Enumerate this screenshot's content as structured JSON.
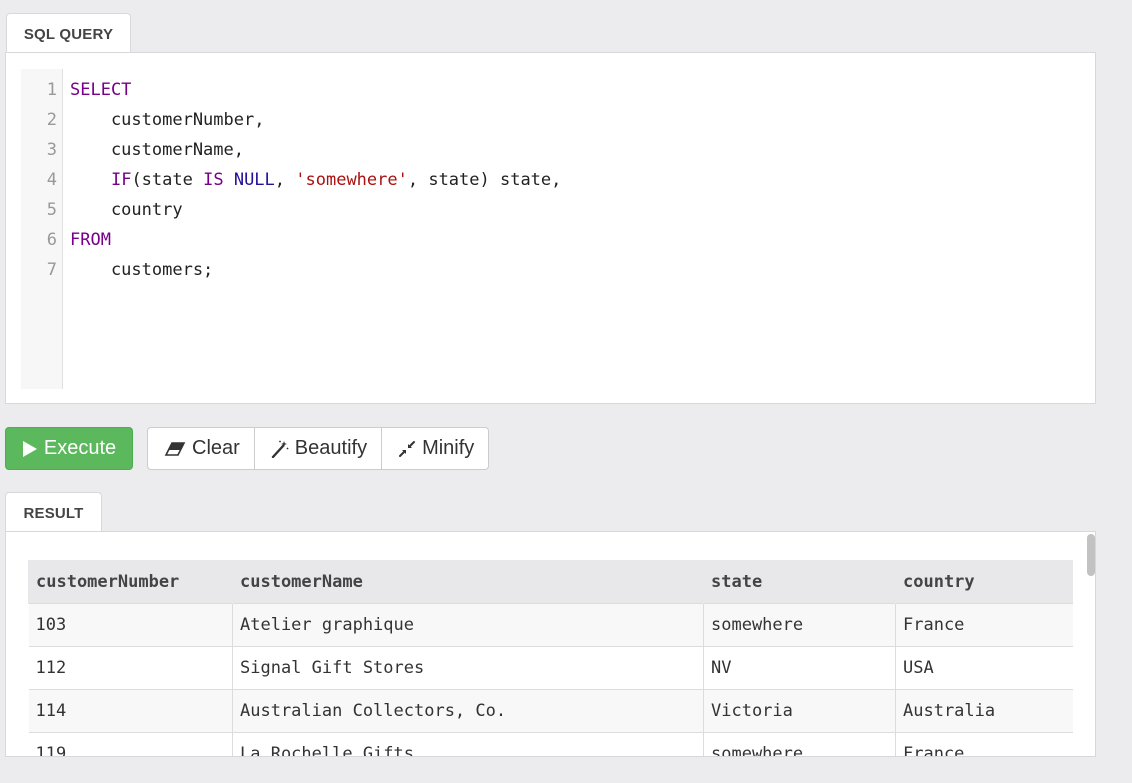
{
  "tabs": {
    "sql": "SQL QUERY",
    "result": "RESULT"
  },
  "editor": {
    "line_numbers": [
      "1",
      "2",
      "3",
      "4",
      "5",
      "6",
      "7"
    ],
    "lines": [
      [
        {
          "t": "SELECT",
          "c": "kw"
        }
      ],
      [
        {
          "t": "    customerNumber,",
          "c": ""
        }
      ],
      [
        {
          "t": "    customerName,",
          "c": ""
        }
      ],
      [
        {
          "t": "    ",
          "c": ""
        },
        {
          "t": "IF",
          "c": "kw"
        },
        {
          "t": "(state ",
          "c": ""
        },
        {
          "t": "IS",
          "c": "kw"
        },
        {
          "t": " ",
          "c": ""
        },
        {
          "t": "NULL",
          "c": "atom"
        },
        {
          "t": ", ",
          "c": ""
        },
        {
          "t": "'somewhere'",
          "c": "str"
        },
        {
          "t": ", state) state,",
          "c": ""
        }
      ],
      [
        {
          "t": "    country",
          "c": ""
        }
      ],
      [
        {
          "t": "FROM",
          "c": "kw"
        }
      ],
      [
        {
          "t": "    customers;",
          "c": ""
        }
      ]
    ]
  },
  "toolbar": {
    "execute_label": "Execute",
    "clear_label": "Clear",
    "beautify_label": "Beautify",
    "minify_label": "Minify"
  },
  "icons": {
    "execute": "play-icon",
    "clear": "eraser-icon",
    "beautify": "magic-wand-icon",
    "minify": "compress-icon"
  },
  "colors": {
    "execute_bg": "#5cb85c",
    "keyword": "#770088",
    "atom": "#221199",
    "string": "#aa1111"
  },
  "result": {
    "columns": [
      "customerNumber",
      "customerName",
      "state",
      "country"
    ],
    "rows": [
      [
        "103",
        "Atelier graphique",
        "somewhere",
        "France"
      ],
      [
        "112",
        "Signal Gift Stores",
        "NV",
        "USA"
      ],
      [
        "114",
        "Australian Collectors, Co.",
        "Victoria",
        "Australia"
      ],
      [
        "119",
        "La Rochelle Gifts",
        "somewhere",
        "France"
      ]
    ]
  }
}
